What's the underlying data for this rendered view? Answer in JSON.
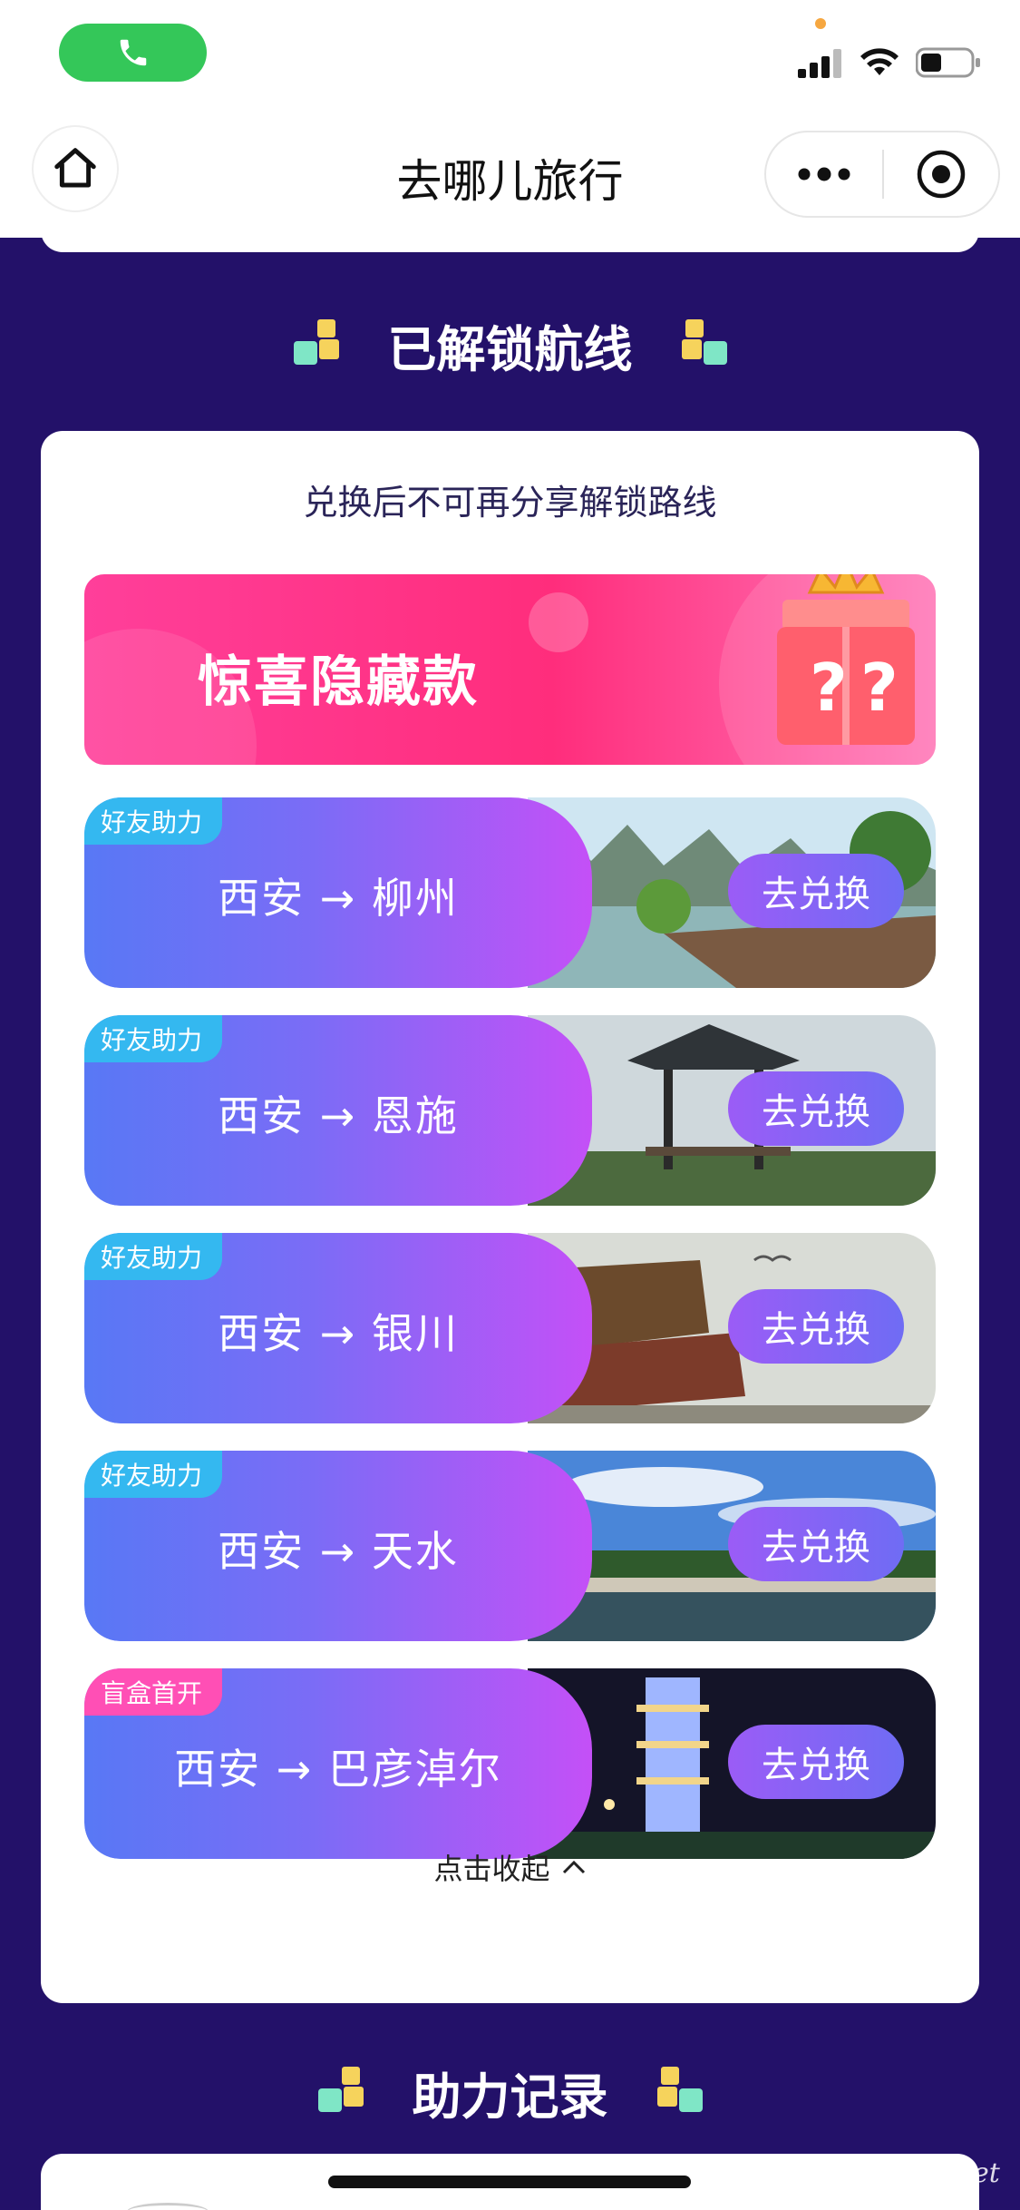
{
  "app": {
    "title": "去哪儿旅行"
  },
  "status_bar": {
    "call_icon": "phone-icon",
    "signal_icon": "signal-icon",
    "wifi_icon": "wifi-icon",
    "battery_icon": "battery-icon"
  },
  "nav": {
    "home_icon": "home-icon",
    "more_icon": "more-dots-icon",
    "close_icon": "target-icon"
  },
  "unlocked": {
    "heading": "已解锁航线",
    "hint": "兑换后不可再分享解锁路线",
    "surprise_label": "惊喜隐藏款",
    "routes": [
      {
        "tag": "好友助力",
        "tag_type": "friend",
        "name": "西安 → 柳州",
        "button": "去兑换"
      },
      {
        "tag": "好友助力",
        "tag_type": "friend",
        "name": "西安 → 恩施",
        "button": "去兑换"
      },
      {
        "tag": "好友助力",
        "tag_type": "friend",
        "name": "西安 → 银川",
        "button": "去兑换"
      },
      {
        "tag": "好友助力",
        "tag_type": "friend",
        "name": "西安 → 天水",
        "button": "去兑换"
      },
      {
        "tag": "盲盒首开",
        "tag_type": "blind",
        "name": "西安 → 巴彦淖尔",
        "button": "去兑换"
      }
    ],
    "collapse_label": "点击收起"
  },
  "help_record": {
    "heading": "助力记录"
  },
  "watermark": "eLvXing.net",
  "colors": {
    "background": "#231169",
    "accent_pink": "#ff2d7c",
    "button_purple": "#8a64f5",
    "tag_blue": "#34b8f0",
    "tag_pink": "#ff4fb5"
  }
}
